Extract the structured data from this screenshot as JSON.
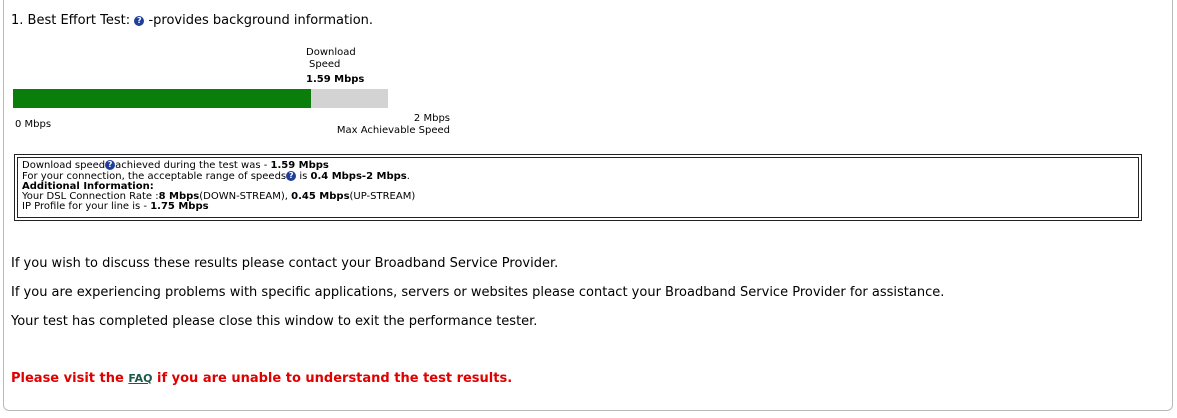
{
  "test": {
    "number": "1.",
    "title": "Best Effort Test:",
    "info_text": "-provides background information."
  },
  "gauge": {
    "label_line1": "Download",
    "label_line2": "Speed",
    "value": "1.59 Mbps",
    "fraction": 0.795,
    "min_label": "0 Mbps",
    "max_value": "2 Mbps",
    "max_caption": "Max Achievable Speed",
    "fill_color": "#0a7d0a",
    "track_color": "#d3d3d3"
  },
  "results": {
    "line1_prefix": "Download speed",
    "line1_mid": "achieved during the test was - ",
    "line1_value": "1.59 Mbps",
    "line2_prefix": "For your connection, the acceptable range of speeds",
    "line2_mid": " is ",
    "line2_value": "0.4 Mbps-2 Mbps",
    "line2_end": ".",
    "additional_heading": "Additional Information:",
    "line4_prefix": "Your DSL Connection Rate :",
    "line4_down": "8 Mbps",
    "line4_down_suffix": "(DOWN-STREAM), ",
    "line4_up": "0.45 Mbps",
    "line4_up_suffix": "(UP-STREAM)",
    "line5_prefix": "IP Profile for your line is - ",
    "line5_value": "1.75 Mbps"
  },
  "messages": {
    "contact": "If you wish to discuss these results please contact your Broadband Service Provider.",
    "problems": "If you are experiencing problems with specific applications, servers or websites please contact your Broadband Service Provider for assistance.",
    "completed": "Your test has completed please close this window to exit the performance tester."
  },
  "faq": {
    "before": "Please visit the ",
    "link": "FAQ",
    "after": " if you are unable to understand the test results.",
    "color": "#e00000"
  },
  "icons": {
    "info_glyph": "?"
  }
}
